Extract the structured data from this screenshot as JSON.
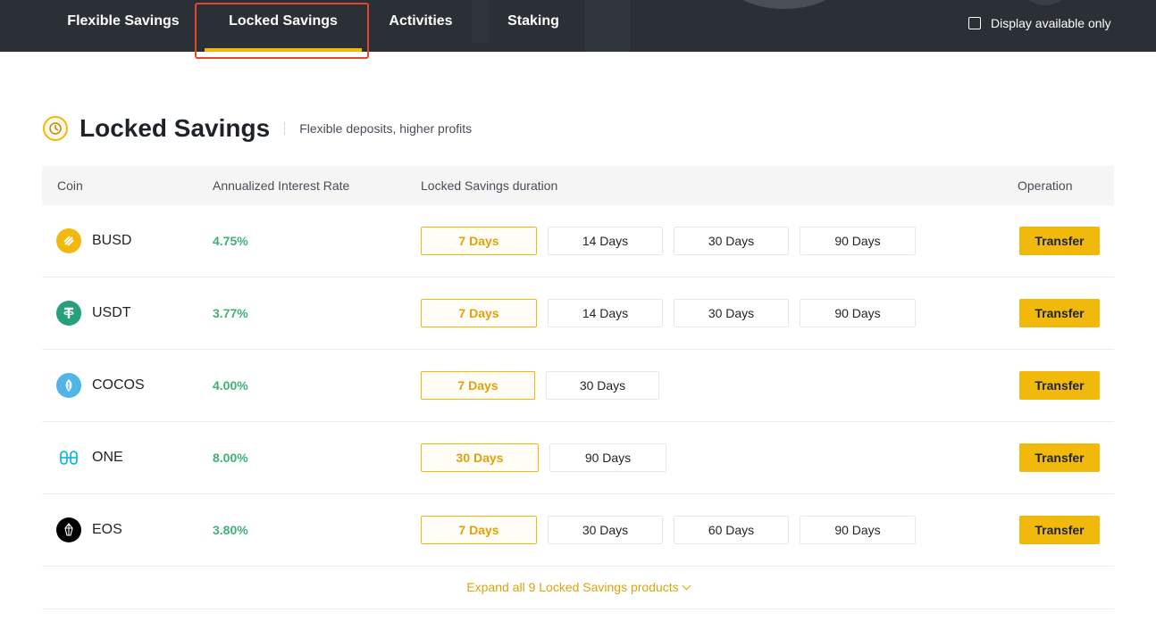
{
  "nav": {
    "tabs": [
      {
        "label": "Flexible Savings",
        "active": false
      },
      {
        "label": "Locked Savings",
        "active": true
      },
      {
        "label": "Activities",
        "active": false
      },
      {
        "label": "Staking",
        "active": false
      }
    ],
    "display_available_only": {
      "label": "Display available only",
      "checked": false
    }
  },
  "section": {
    "title": "Locked Savings",
    "subtitle": "Flexible deposits, higher profits"
  },
  "table": {
    "headers": {
      "coin": "Coin",
      "rate": "Annualized Interest Rate",
      "duration": "Locked Savings duration",
      "operation": "Operation"
    },
    "rows": [
      {
        "coin": "BUSD",
        "icon": "busd-icon",
        "color": "#f0b90b",
        "rate": "4.75%",
        "durations": [
          "7 Days",
          "14 Days",
          "30 Days",
          "90 Days"
        ],
        "selected": 0,
        "action": "Transfer"
      },
      {
        "coin": "USDT",
        "icon": "usdt-icon",
        "color": "#26a17b",
        "rate": "3.77%",
        "durations": [
          "7 Days",
          "14 Days",
          "30 Days",
          "90 Days"
        ],
        "selected": 0,
        "action": "Transfer"
      },
      {
        "coin": "COCOS",
        "icon": "cocos-icon",
        "color": "#52b5e8",
        "rate": "4.00%",
        "durations": [
          "7 Days",
          "30 Days"
        ],
        "selected": 0,
        "action": "Transfer"
      },
      {
        "coin": "ONE",
        "icon": "one-icon",
        "color": "#00aee9",
        "rate": "8.00%",
        "durations": [
          "30 Days",
          "90 Days"
        ],
        "selected": 0,
        "action": "Transfer"
      },
      {
        "coin": "EOS",
        "icon": "eos-icon",
        "color": "#000000",
        "rate": "3.80%",
        "durations": [
          "7 Days",
          "30 Days",
          "60 Days",
          "90 Days"
        ],
        "selected": 0,
        "action": "Transfer"
      }
    ],
    "expand_label": "Expand all 9 Locked Savings products"
  },
  "colors": {
    "accent": "#f0b90b",
    "positive": "#3fb07a",
    "nav_bg": "#2b2f36",
    "highlight": "#e0482e"
  }
}
